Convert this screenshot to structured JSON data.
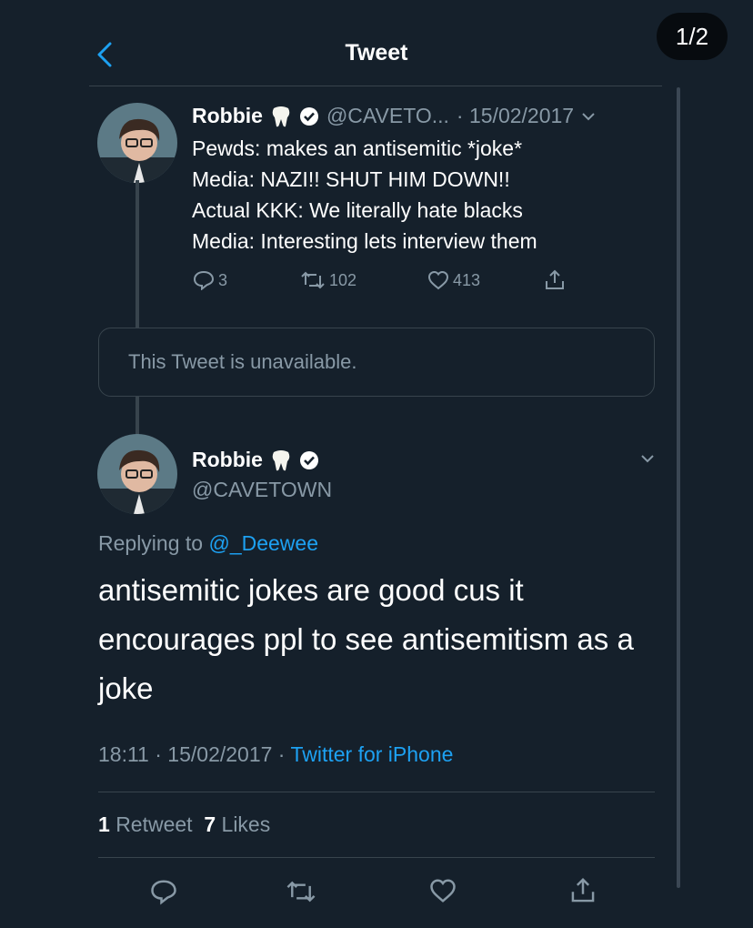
{
  "header": {
    "title": "Tweet",
    "page_counter": "1/2"
  },
  "quoted_tweet": {
    "author_name": "Robbie",
    "handle": "@CAVETO...",
    "date": "· 15/02/2017",
    "text": "Pewds: makes an antisemitic *joke*\nMedia: NAZI!! SHUT HIM DOWN!!\nActual KKK: We literally hate blacks\nMedia: Interesting lets interview them",
    "reply_count": "3",
    "retweet_count": "102",
    "like_count": "413"
  },
  "unavailable_notice": "This Tweet is unavailable.",
  "main_tweet": {
    "author_name": "Robbie",
    "handle": "@CAVETOWN",
    "replying_label": "Replying to",
    "replying_to": "@_Deewee",
    "text": "antisemitic jokes are good cus it encourages ppl to see antisemitism as a joke",
    "time": "18:11",
    "date": "· 15/02/2017 ·",
    "source": "Twitter for iPhone",
    "retweets_count": "1",
    "retweets_label": "Retweet",
    "likes_count": "7",
    "likes_label": "Likes"
  },
  "icons": {
    "back": "chevron-left-icon",
    "verified": "verified-badge-icon",
    "tooth": "tooth-emoji-icon",
    "reply": "reply-icon",
    "retweet": "retweet-icon",
    "like": "heart-icon",
    "share": "share-icon"
  },
  "colors": {
    "background": "#15202b",
    "accent": "#1da1f2",
    "muted": "#8899a6",
    "divider": "#38444d"
  }
}
